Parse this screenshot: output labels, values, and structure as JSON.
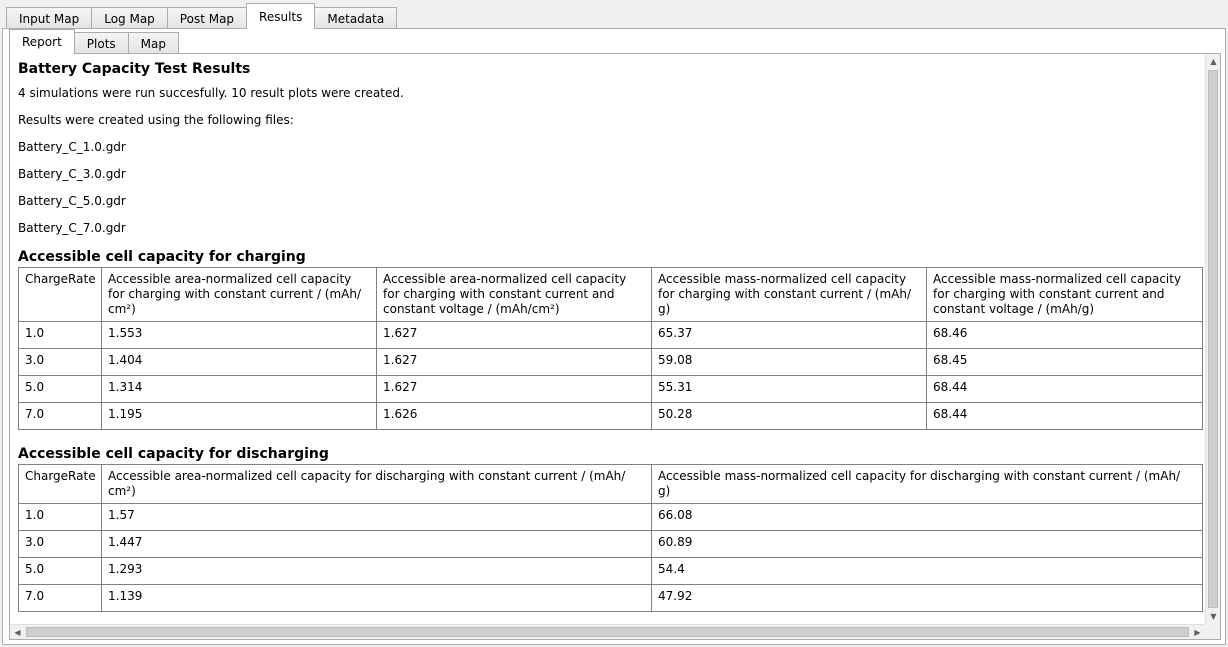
{
  "main_tabs": [
    "Input Map",
    "Log Map",
    "Post Map",
    "Results",
    "Metadata"
  ],
  "sub_tabs": [
    "Report",
    "Plots",
    "Map"
  ],
  "report": {
    "title": "Battery Capacity Test Results",
    "summary": "4 simulations were run succesfully. 10 result plots were created.",
    "files_intro": "Results were created using the following files:",
    "files": [
      "Battery_C_1.0.gdr",
      "Battery_C_3.0.gdr",
      "Battery_C_5.0.gdr",
      "Battery_C_7.0.gdr"
    ]
  },
  "charging_table": {
    "heading": "Accessible cell capacity for charging",
    "columns": [
      "ChargeRate",
      "Accessible area-normalized cell capacity for charging with constant current / (mAh/ cm²)",
      "Accessible area-normalized cell capacity for charging with constant current and constant voltage / (mAh/cm²)",
      "Accessible mass-normalized cell capacity for charging with constant current / (mAh/ g)",
      "Accessible mass-normalized cell capacity for charging with constant current and constant voltage / (mAh/g)"
    ],
    "rows": [
      [
        "1.0",
        "1.553",
        "1.627",
        "65.37",
        "68.46"
      ],
      [
        "3.0",
        "1.404",
        "1.627",
        "59.08",
        "68.45"
      ],
      [
        "5.0",
        "1.314",
        "1.627",
        "55.31",
        "68.44"
      ],
      [
        "7.0",
        "1.195",
        "1.626",
        "50.28",
        "68.44"
      ]
    ]
  },
  "discharging_table": {
    "heading": "Accessible cell capacity for discharging",
    "columns": [
      "ChargeRate",
      "Accessible area-normalized cell capacity for discharging with constant current / (mAh/ cm²)",
      "Accessible mass-normalized cell capacity for discharging with constant current / (mAh/ g)"
    ],
    "rows": [
      [
        "1.0",
        "1.57",
        "66.08"
      ],
      [
        "3.0",
        "1.447",
        "60.89"
      ],
      [
        "5.0",
        "1.293",
        "54.4"
      ],
      [
        "7.0",
        "1.139",
        "47.92"
      ]
    ]
  },
  "scrollbar": {
    "up_arrow": "▲",
    "down_arrow": "▼",
    "left_arrow": "◀",
    "right_arrow": "▶"
  }
}
